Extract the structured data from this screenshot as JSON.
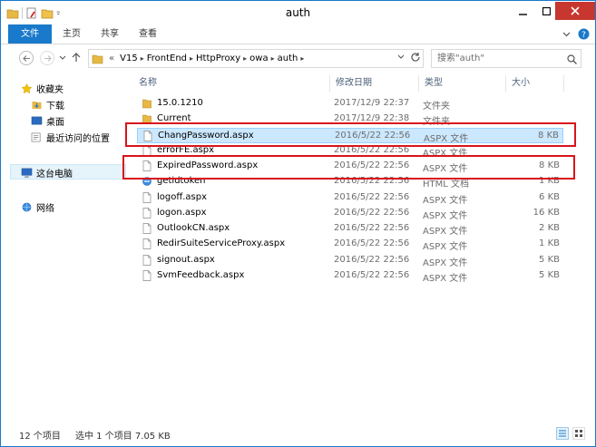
{
  "window": {
    "title": "auth"
  },
  "ribbon": {
    "tabs": [
      {
        "label": "文件"
      },
      {
        "label": "主页"
      },
      {
        "label": "共享"
      },
      {
        "label": "查看"
      }
    ]
  },
  "address": {
    "prefix": "«",
    "segments": [
      "V15",
      "FrontEnd",
      "HttpProxy",
      "owa",
      "auth"
    ]
  },
  "search": {
    "placeholder": "搜索\"auth\""
  },
  "sidebar": {
    "items": [
      {
        "label": "收藏夹",
        "icon": "star-icon"
      },
      {
        "label": "下载",
        "icon": "download-folder-icon"
      },
      {
        "label": "桌面",
        "icon": "desktop-icon"
      },
      {
        "label": "最近访问的位置",
        "icon": "recent-places-icon"
      },
      {
        "label": "这台电脑",
        "icon": "computer-icon"
      },
      {
        "label": "网络",
        "icon": "network-icon"
      }
    ]
  },
  "columns": {
    "name": "名称",
    "date": "修改日期",
    "type": "类型",
    "size": "大小"
  },
  "files": [
    {
      "name": "15.0.1210",
      "date": "2017/12/9 22:37",
      "type": "文件夹",
      "size": "",
      "icon": "folder-icon"
    },
    {
      "name": "Current",
      "date": "2017/12/9 22:38",
      "type": "文件夹",
      "size": "",
      "icon": "folder-icon"
    },
    {
      "name": "ChangPassword.aspx",
      "date": "2016/5/22 22:56",
      "type": "ASPX 文件",
      "size": "8 KB",
      "icon": "file-icon",
      "selected": true
    },
    {
      "name": "errorFE.aspx",
      "date": "2016/5/22 22:56",
      "type": "ASPX 文件",
      "size": "",
      "icon": "file-icon"
    },
    {
      "name": "ExpiredPassword.aspx",
      "date": "2016/5/22 22:56",
      "type": "ASPX 文件",
      "size": "8 KB",
      "icon": "file-icon"
    },
    {
      "name": "getidtoken",
      "date": "2016/5/22 22:56",
      "type": "HTML 文档",
      "size": "1 KB",
      "icon": "html-icon"
    },
    {
      "name": "logoff.aspx",
      "date": "2016/5/22 22:56",
      "type": "ASPX 文件",
      "size": "6 KB",
      "icon": "file-icon"
    },
    {
      "name": "logon.aspx",
      "date": "2016/5/22 22:56",
      "type": "ASPX 文件",
      "size": "16 KB",
      "icon": "file-icon"
    },
    {
      "name": "OutlookCN.aspx",
      "date": "2016/5/22 22:56",
      "type": "ASPX 文件",
      "size": "2 KB",
      "icon": "file-icon"
    },
    {
      "name": "RedirSuiteServiceProxy.aspx",
      "date": "2016/5/22 22:56",
      "type": "ASPX 文件",
      "size": "1 KB",
      "icon": "file-icon"
    },
    {
      "name": "signout.aspx",
      "date": "2016/5/22 22:56",
      "type": "ASPX 文件",
      "size": "5 KB",
      "icon": "file-icon"
    },
    {
      "name": "SvmFeedback.aspx",
      "date": "2016/5/22 22:56",
      "type": "ASPX 文件",
      "size": "5 KB",
      "icon": "file-icon"
    }
  ],
  "status": {
    "count": "12 个项目",
    "selection": "选中 1 个项目  7.05 KB"
  },
  "colors": {
    "accent": "#1979ca",
    "highlight": "#d9141b",
    "selection": "#cce8ff"
  }
}
